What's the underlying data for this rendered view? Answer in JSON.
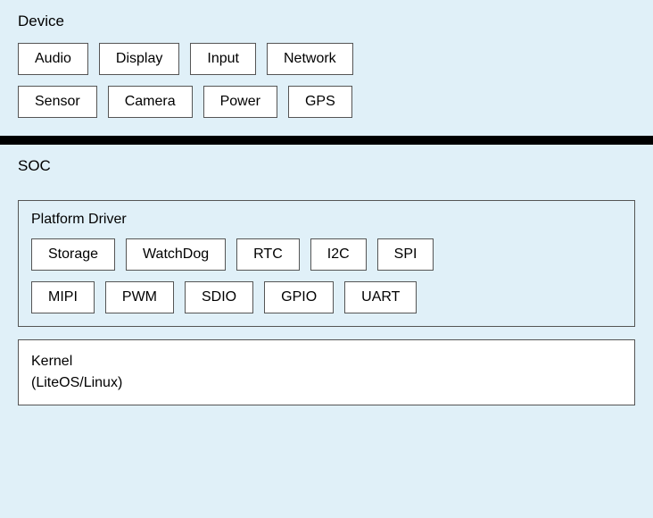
{
  "device": {
    "label": "Device",
    "row1": [
      "Audio",
      "Display",
      "Input",
      "Network"
    ],
    "row2": [
      "Sensor",
      "Camera",
      "Power",
      "GPS"
    ]
  },
  "soc": {
    "label": "SOC",
    "platformDriver": {
      "label": "Platform Driver",
      "row1": [
        "Storage",
        "WatchDog",
        "RTC",
        "I2C",
        "SPI"
      ],
      "row2": [
        "MIPI",
        "PWM",
        "SDIO",
        "GPIO",
        "UART"
      ]
    },
    "kernel": {
      "label": "Kernel\n(LiteOS/Linux)"
    }
  }
}
